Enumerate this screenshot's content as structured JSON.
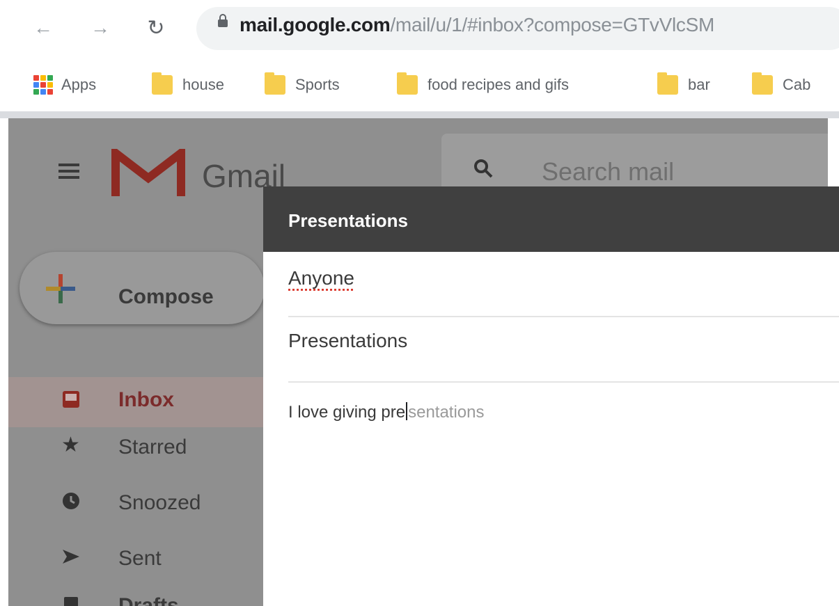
{
  "browser": {
    "url_host": "mail.google.com",
    "url_path": "/mail/u/1/#inbox?compose=GTvVlcSM",
    "bookmarks": [
      "Apps",
      "house",
      "Sports",
      "food recipes and gifs",
      "bar",
      "Cab"
    ]
  },
  "gmail": {
    "app_name": "Gmail",
    "search_placeholder": "Search mail",
    "compose_label": "Compose",
    "nav": [
      "Inbox",
      "Starred",
      "Snoozed",
      "Sent",
      "Drafts"
    ]
  },
  "compose": {
    "window_title": "Presentations",
    "to": "Anyone",
    "subject": "Presentations",
    "body_start": "I love giving pre",
    "body_end": "sentations"
  }
}
